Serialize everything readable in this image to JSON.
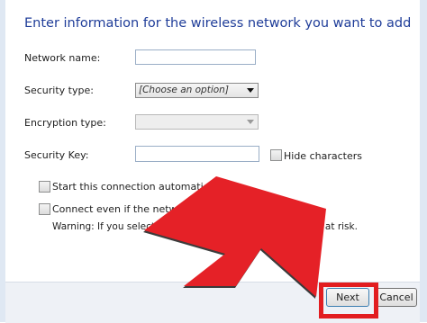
{
  "dialog": {
    "title": "Enter information for the wireless network you want to add"
  },
  "fields": {
    "network_name": {
      "label": "Network name:",
      "value": ""
    },
    "security_type": {
      "label": "Security type:",
      "value": "[Choose an option]"
    },
    "encryption_type": {
      "label": "Encryption type:",
      "value": ""
    },
    "security_key": {
      "label": "Security Key:",
      "value": ""
    }
  },
  "options": {
    "hide_characters": {
      "label": "Hide characters",
      "checked": false
    },
    "start_automatically": {
      "label": "Start this connection automatically",
      "checked": false
    },
    "connect_even_if": {
      "label": "Connect even if the network is not broadca",
      "checked": false
    }
  },
  "warning": "Warning: If you select th",
  "warning_tail": "y might be at risk.",
  "buttons": {
    "next": "Next",
    "cancel": "Cancel"
  },
  "overlay": {
    "arrow_color": "#e52127",
    "highlight_color": "#e21d20",
    "icon": "red-pointer-arrow-icon"
  }
}
